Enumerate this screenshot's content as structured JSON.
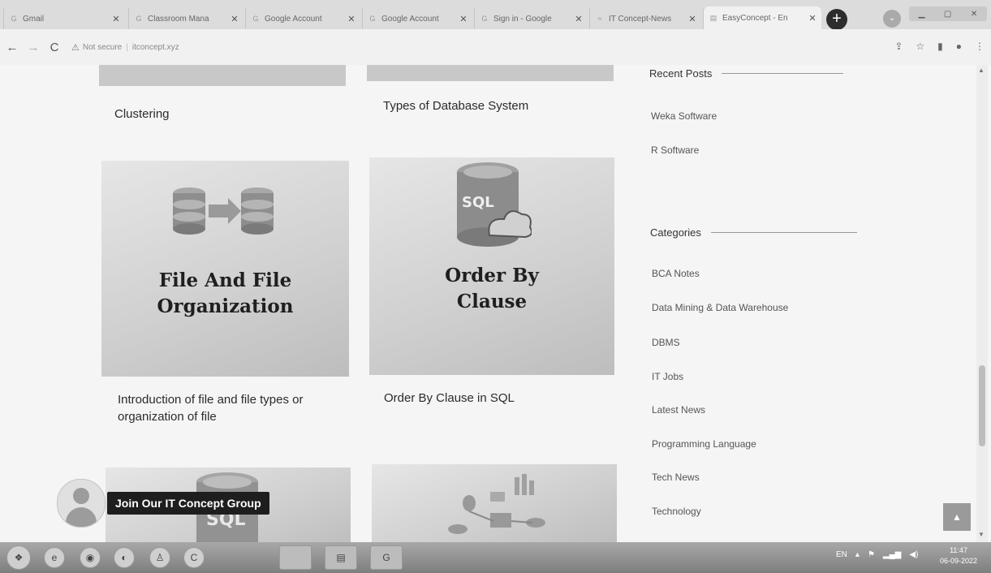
{
  "browser": {
    "tabs": [
      {
        "title": "Gmail",
        "favicon": "google-g-icon"
      },
      {
        "title": "Classroom Mana",
        "favicon": "google-g-icon"
      },
      {
        "title": "Google Account",
        "favicon": "google-g-icon"
      },
      {
        "title": "Google Account",
        "favicon": "google-g-icon"
      },
      {
        "title": "Sign in - Google",
        "favicon": "google-g-icon"
      },
      {
        "title": "IT Concept-News",
        "favicon": "site-icon"
      },
      {
        "title": "EasyConcept - En",
        "favicon": "doc-icon"
      }
    ],
    "new_tab": "+",
    "address": {
      "security": "Not secure",
      "url": "itconcept.xyz"
    }
  },
  "posts": [
    {
      "title": "Clustering"
    },
    {
      "title": "Types of Database System"
    },
    {
      "title": "Introduction of file and file types or organization of file",
      "thumb_text": "File And File Organization"
    },
    {
      "title": "Order By Clause in SQL",
      "thumb_text": "Order By Clause",
      "thumb_badge": "SQL"
    },
    {
      "thumb_badge": "SQL"
    }
  ],
  "sidebar": {
    "recent_heading": "Recent Posts",
    "recent": [
      "Weka Software",
      "R Software"
    ],
    "categories_heading": "Categories",
    "categories": [
      "BCA Notes",
      "Data Mining & Data Warehouse",
      "DBMS",
      "IT Jobs",
      "Latest News",
      "Programming Language",
      "Tech News",
      "Technology"
    ]
  },
  "join_group": {
    "label": "Join Our IT Concept Group"
  },
  "taskbar": {
    "lang": "EN",
    "time": "11:47",
    "date": "06-09-2022"
  }
}
